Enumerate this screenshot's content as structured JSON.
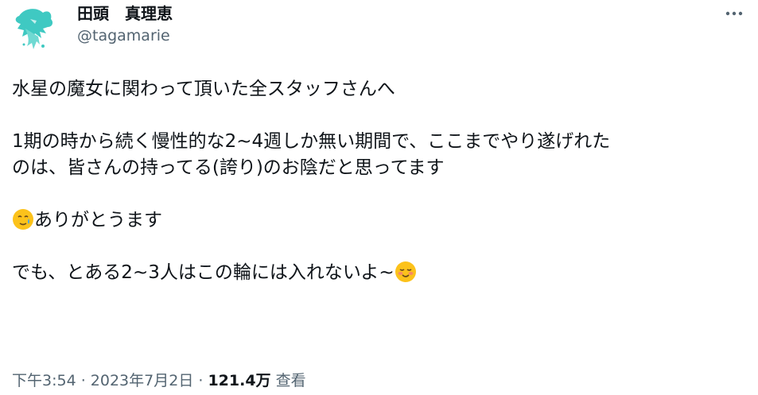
{
  "author": {
    "display_name": "田頭　真理恵",
    "handle": "@tagamarie"
  },
  "more_icon": "more-horizontal-icon",
  "tweet": {
    "line1": "水星の魔女に関わって頂いた全スタッフさんへ",
    "line2": "1期の時から続く慢性的な2~4週しか無い期間で、ここまでやり遂げれた",
    "line3": "のは、皆さんの持ってる(誇り)のお陰だと思ってます",
    "line4_text": "ありがとうます",
    "line4_emoji": "face-holding-back-tears-icon",
    "line5_text": "でも、とある2~3人はこの輪には入れないよ~",
    "line5_emoji": "smiling-face-icon"
  },
  "meta": {
    "time": "下午3:54",
    "sep1": " · ",
    "date": "2023年7月2日",
    "sep2": " · ",
    "views_count": "121.4万",
    "views_label": " 查看"
  },
  "colors": {
    "text": "#0f1419",
    "secondary": "#536471",
    "avatar_teal": "#3fc9c2",
    "emoji_yellow": "#fcc21b"
  }
}
